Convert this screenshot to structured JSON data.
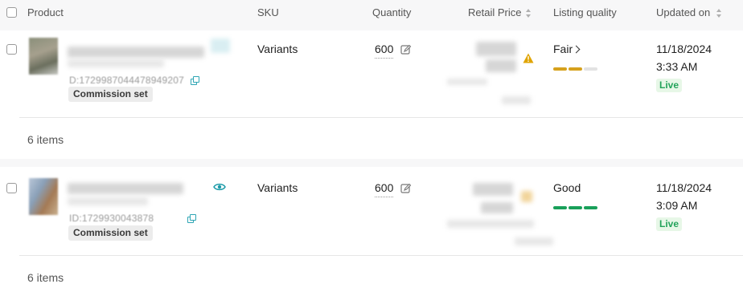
{
  "table": {
    "columns": [
      {
        "label": "Product",
        "sortable": false
      },
      {
        "label": "SKU",
        "sortable": false
      },
      {
        "label": "Quantity",
        "sortable": false
      },
      {
        "label": "Retail Price",
        "sortable": true
      },
      {
        "label": "Listing quality",
        "sortable": false
      },
      {
        "label": "Updated on",
        "sortable": true
      }
    ],
    "rows": [
      {
        "product_id": "D:1729987044478949207",
        "tag": "Commission set",
        "sku": "Variants",
        "quantity": "600",
        "quality": "Fair",
        "quality_level": "2/3",
        "date": "11/18/2024",
        "time": "3:33 AM",
        "status": "Live",
        "items_count": "6 items"
      },
      {
        "product_id": "ID:1729930043878",
        "tag": "Commission set",
        "sku": "Variants",
        "quantity": "600",
        "quality": "Good",
        "quality_level": "3/3",
        "date": "11/18/2024",
        "time": "3:09 AM",
        "status": "Live",
        "items_count": "6 items"
      }
    ]
  },
  "colors": {
    "fair": "#d6a11c",
    "good": "#19a05a",
    "inactive_bar": "#e2e2e2",
    "live_bg": "#e7f7e7",
    "live_text": "#23a35a",
    "warning": "#e0a400"
  }
}
